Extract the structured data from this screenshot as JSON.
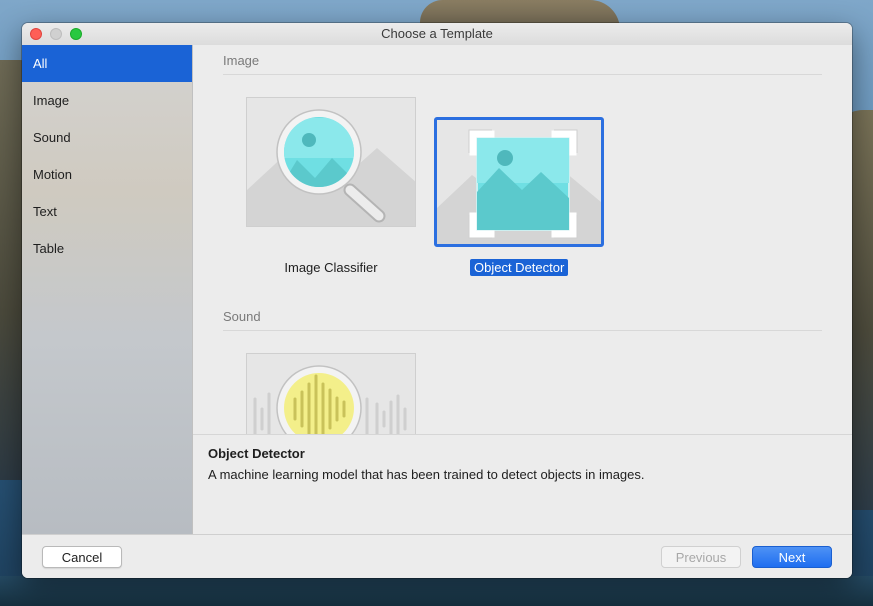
{
  "window": {
    "title": "Choose a Template"
  },
  "sidebar": {
    "items": [
      {
        "label": "All",
        "selected": true
      },
      {
        "label": "Image",
        "selected": false
      },
      {
        "label": "Sound",
        "selected": false
      },
      {
        "label": "Motion",
        "selected": false
      },
      {
        "label": "Text",
        "selected": false
      },
      {
        "label": "Table",
        "selected": false
      }
    ]
  },
  "sections": [
    {
      "label": "Image",
      "templates": [
        {
          "label": "Image Classifier",
          "icon": "image-classifier-icon",
          "selected": false
        },
        {
          "label": "Object Detector",
          "icon": "object-detector-icon",
          "selected": true
        }
      ]
    },
    {
      "label": "Sound",
      "templates": [
        {
          "label": "",
          "icon": "sound-classifier-icon",
          "selected": false
        }
      ]
    }
  ],
  "description": {
    "title": "Object Detector",
    "text": "A machine learning model that has been trained to detect objects in images."
  },
  "footer": {
    "cancel_label": "Cancel",
    "previous_label": "Previous",
    "next_label": "Next",
    "previous_enabled": false
  },
  "colors": {
    "accent": "#1a63d6",
    "image_icon": "#5fd8dc",
    "sound_icon": "#f3ef8a"
  }
}
